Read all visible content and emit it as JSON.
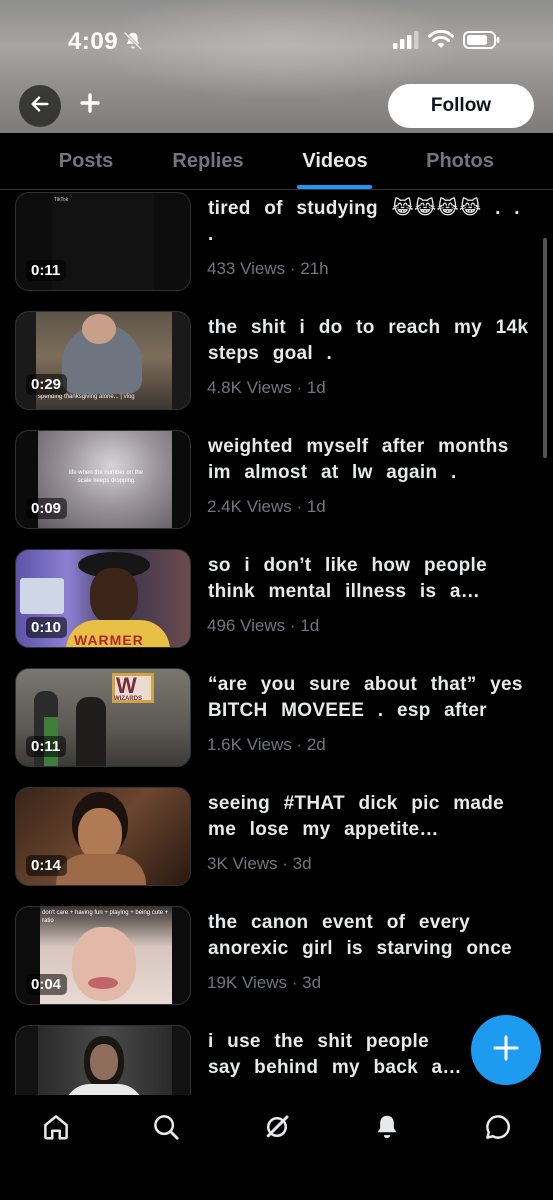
{
  "status_bar": {
    "time": "4:09"
  },
  "header": {
    "follow_label": "Follow"
  },
  "tabs": [
    {
      "label": "Posts",
      "active": false
    },
    {
      "label": "Replies",
      "active": false
    },
    {
      "label": "Videos",
      "active": true
    },
    {
      "label": "Photos",
      "active": false
    }
  ],
  "videos": [
    {
      "duration": "0:11",
      "caption": "tired of studying 😹😹😹😹 . . .",
      "meta": "433 Views · 21h",
      "thumb_text": "TikTok"
    },
    {
      "duration": "0:29",
      "caption": "the shit i do to reach my 14k steps goal .",
      "meta": "4.8K Views · 1d",
      "thumb_text": "spending thanksgiving alone... | vlog"
    },
    {
      "duration": "0:09",
      "caption": "weighted myself after months im almost at lw again .",
      "meta": "2.4K Views · 1d",
      "thumb_text": "life when the number on the scale keeps dropping"
    },
    {
      "duration": "0:10",
      "caption": "so i don’t like how people think mental illness is a chemical imbalance",
      "meta": "496 Views · 1d",
      "thumb_text": "WARMER"
    },
    {
      "duration": "0:11",
      "caption": "“are you sure about that” yes BITCH MOVEEE . esp after",
      "meta": "1.6K Views · 2d",
      "thumb_text": "WIZARDS"
    },
    {
      "duration": "0:14",
      "caption": "seeing #THAT dick pic made me lose my appetite completely",
      "meta": "3K Views · 3d",
      "thumb_text": ""
    },
    {
      "duration": "0:04",
      "caption": "the canon event of every anorexic girl is starving once",
      "meta": "19K Views · 3d",
      "thumb_text": "don't care + having fun + playing + being cute + ratio"
    },
    {
      "duration": "",
      "caption": "i use the shit people say behind my back as meanspo",
      "meta": "",
      "thumb_text": ""
    }
  ],
  "colors": {
    "accent": "#1d9bf0",
    "background": "#000000",
    "secondary_text": "#71767b"
  },
  "nav_icons": [
    "home-icon",
    "search-icon",
    "grok-icon",
    "notifications-icon",
    "messages-icon"
  ]
}
